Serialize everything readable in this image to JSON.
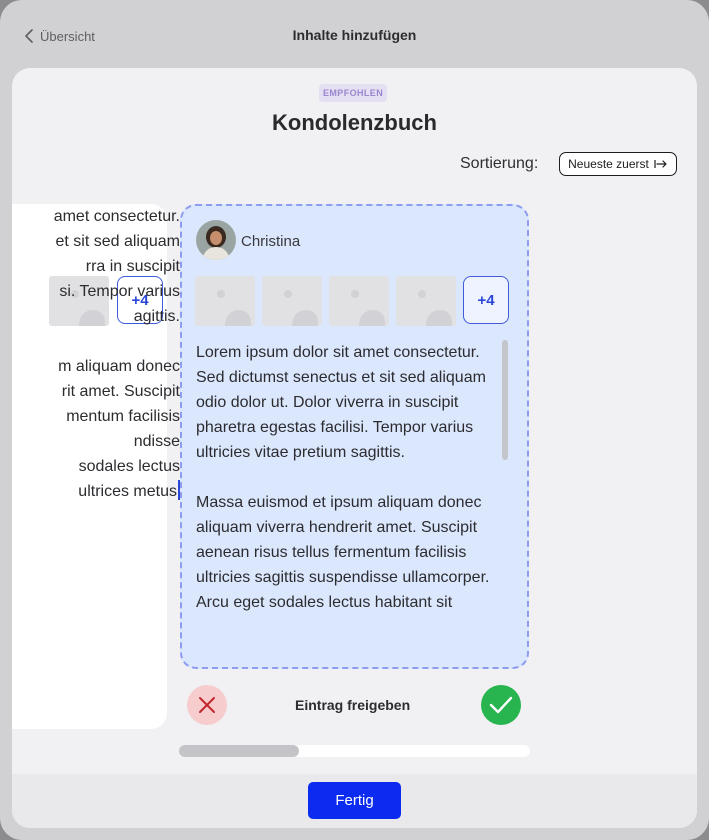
{
  "topbar": {
    "back_label": "Übersicht",
    "title": "Inhalte hinzufügen"
  },
  "sheet": {
    "badge": "EMPFOHLEN",
    "title": "Kondolenzbuch",
    "sort_label": "Sortierung:",
    "sort_value": "Neueste zuerst"
  },
  "left_card": {
    "more_label": "+4",
    "lines": [
      "amet consectetur.",
      "et sit sed aliquam",
      "rra in suscipit",
      "si. Tempor varius",
      "agittis.",
      "",
      "m aliquam donec",
      "rit amet. Suscipit",
      "mentum facilisis",
      "ndisse",
      "sodales lectus",
      "ultrices metus"
    ]
  },
  "right_card": {
    "author": "Christina",
    "more_label": "+4",
    "paragraph1": "Lorem ipsum dolor sit amet consectetur. Sed dictumst senectus et sit sed aliquam odio dolor ut. Dolor viverra in suscipit pharetra egestas facilisi. Tempor varius ultricies vitae pretium sagittis.",
    "paragraph2": "Massa euismod et ipsum aliquam donec aliquam viverra hendrerit amet. Suscipit aenean risus tellus fermentum facilisis ultricies sagittis suspendisse ullamcorper. Arcu eget sodales lectus habitant sit"
  },
  "actions": {
    "label": "Eintrag freigeben",
    "reject_icon": "close-icon",
    "approve_icon": "check-icon"
  },
  "footer": {
    "done_label": "Fertig"
  },
  "colors": {
    "accent": "#0b2cf0",
    "approve": "#28b44f",
    "reject_bg": "#f6cccd",
    "card_highlight": "#dbe7fd"
  }
}
